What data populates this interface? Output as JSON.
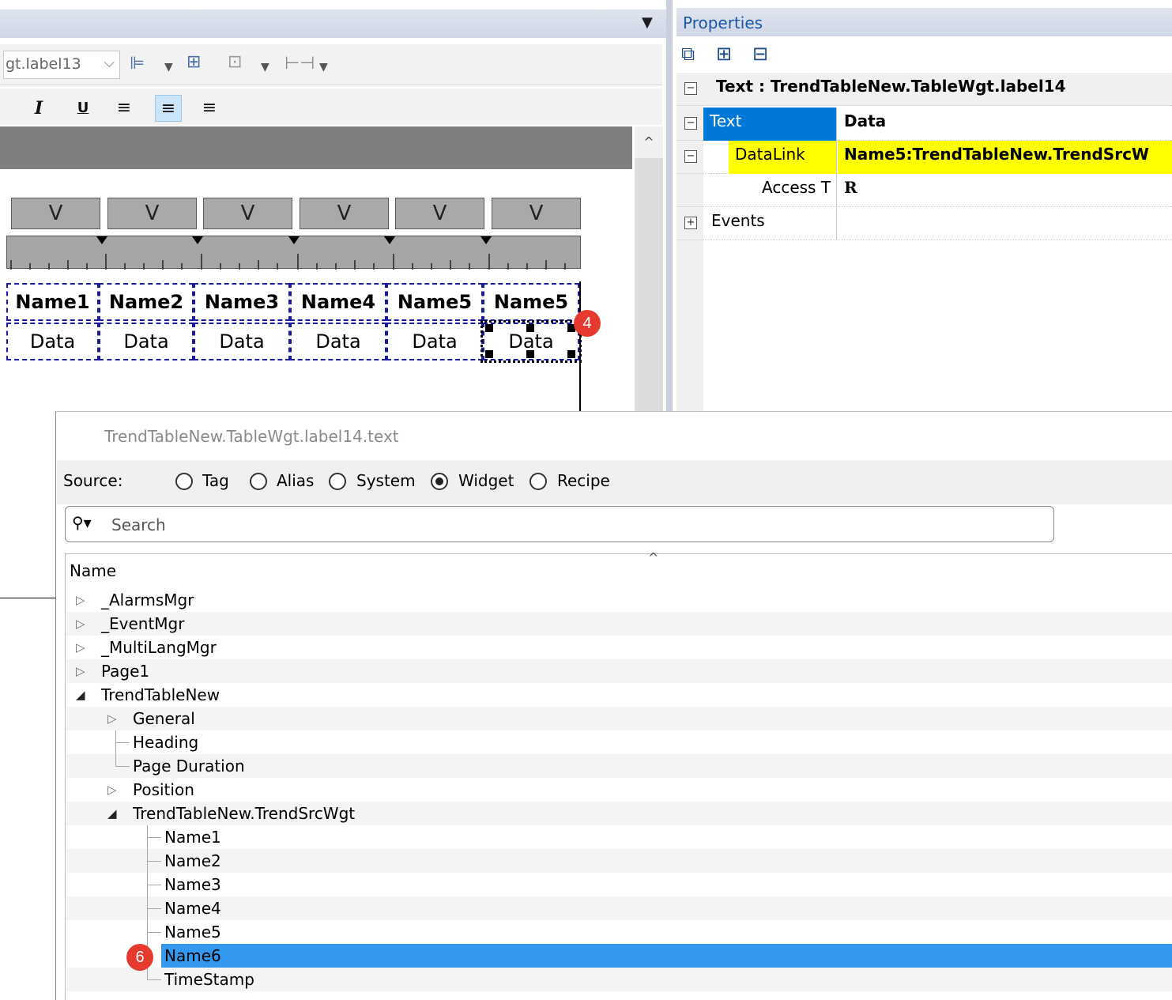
{
  "editor": {
    "combo_value": "gt.label13",
    "format_buttons": [
      {
        "label": "I"
      },
      {
        "label": "U"
      },
      {
        "label": "≡"
      },
      {
        "label": "≡"
      },
      {
        "label": "≡"
      }
    ],
    "column_buttons": [
      "V",
      "V",
      "V",
      "V",
      "V",
      "V"
    ],
    "table_headers": [
      "Name1",
      "Name2",
      "Name3",
      "Name4",
      "Name5",
      "Name5"
    ],
    "table_cells": [
      "Data",
      "Data",
      "Data",
      "Data",
      "Data",
      "Data"
    ],
    "badge_4": "4"
  },
  "properties": {
    "title": "Properties",
    "section_header": "Text : TrendTableNew.TableWgt.label14",
    "rows": [
      {
        "name": "Text",
        "value": "Data"
      },
      {
        "name": "DataLink",
        "value": "Name5:TrendTableNew.TrendSrcW"
      },
      {
        "name": "Access T",
        "value": "R"
      },
      {
        "name": "Events",
        "value": ""
      }
    ],
    "colors": {
      "selected": "#0078d7",
      "datalink_highlight": "#ffff00"
    }
  },
  "dialog": {
    "title": "TrendTableNew.TableWgt.label14.text",
    "source_label": "Source:",
    "sources": [
      {
        "label": "Tag",
        "selected": false
      },
      {
        "label": "Alias",
        "selected": false
      },
      {
        "label": "System",
        "selected": false
      },
      {
        "label": "Widget",
        "selected": true
      },
      {
        "label": "Recipe",
        "selected": false
      }
    ],
    "search_placeholder": "Search",
    "column_header": "Name",
    "tree": [
      {
        "label": "_AlarmsMgr"
      },
      {
        "label": "_EventMgr"
      },
      {
        "label": "_MultiLangMgr"
      },
      {
        "label": "Page1"
      },
      {
        "label": "TrendTableNew"
      },
      {
        "label": "General"
      },
      {
        "label": "Heading"
      },
      {
        "label": "Page Duration"
      },
      {
        "label": "Position"
      },
      {
        "label": "TrendTableNew.TrendSrcWgt"
      },
      {
        "label": "Name1"
      },
      {
        "label": "Name2"
      },
      {
        "label": "Name3"
      },
      {
        "label": "Name4"
      },
      {
        "label": "Name5"
      },
      {
        "label": "Name6"
      },
      {
        "label": "TimeStamp"
      }
    ],
    "selected_item": "Name6",
    "badge_6": "6"
  }
}
